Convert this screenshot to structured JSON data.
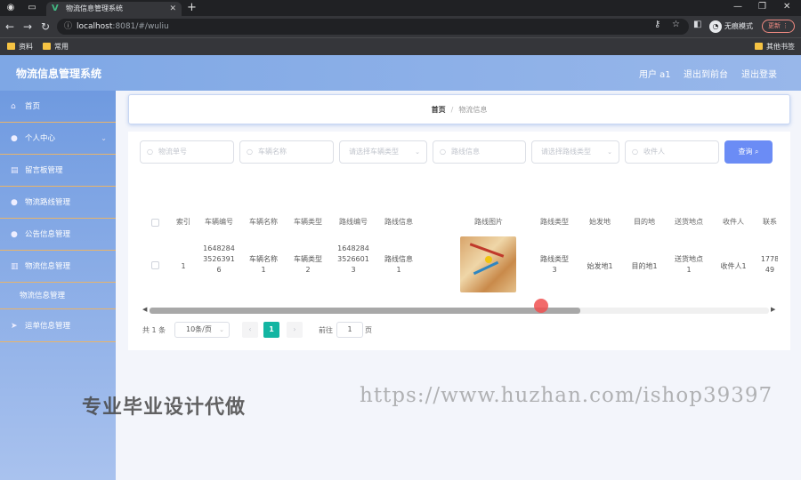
{
  "browser": {
    "tab_title": "物流信息管理系统",
    "url_host": "localhost",
    "url_port": ":8081",
    "url_path": "/#/wuliu",
    "incognito_label": "无痕模式",
    "update_label": "更新",
    "bookmarks": [
      "资料",
      "常用"
    ],
    "other_bookmarks": "其他书签",
    "accent": "#42b883"
  },
  "header": {
    "title": "物流信息管理系统",
    "user_label": "用户 a1",
    "back_label": "退出到前台",
    "logout_label": "退出登录"
  },
  "sidebar": {
    "items": [
      {
        "label": "首页",
        "icon": "home-icon"
      },
      {
        "label": "个人中心",
        "icon": "user-icon"
      },
      {
        "label": "留言板管理",
        "icon": "message-icon"
      },
      {
        "label": "物流路线管理",
        "icon": "user-icon"
      },
      {
        "label": "公告信息管理",
        "icon": "user-icon"
      },
      {
        "label": "物流信息管理",
        "icon": "document-icon"
      },
      {
        "label": "运单信息管理",
        "icon": "send-icon"
      }
    ],
    "sub_item": "物流信息管理"
  },
  "breadcrumb": {
    "home": "首页",
    "separator": "/",
    "current": "物流信息"
  },
  "search": {
    "fields": [
      {
        "placeholder": "物流单号",
        "type": "text"
      },
      {
        "placeholder": "车辆名称",
        "type": "text"
      },
      {
        "placeholder": "请选择车辆类型",
        "type": "select"
      },
      {
        "placeholder": "路线信息",
        "type": "text"
      },
      {
        "placeholder": "请选择路线类型",
        "type": "select"
      },
      {
        "placeholder": "收件人",
        "type": "text"
      }
    ],
    "button": "查询"
  },
  "table": {
    "headers": [
      "索引",
      "车辆编号",
      "车辆名称",
      "车辆类型",
      "路线编号",
      "路线信息",
      "路线图片",
      "路线类型",
      "始发地",
      "目的地",
      "送货地点",
      "收件人",
      "联系"
    ],
    "row": {
      "index": "1",
      "vehicle_no": [
        "1648284",
        "3526391",
        "6"
      ],
      "vehicle_name": [
        "车辆名称",
        "1"
      ],
      "vehicle_type": [
        "车辆类型",
        "2"
      ],
      "route_no": [
        "1648284",
        "3526601",
        "3"
      ],
      "route_info": [
        "路线信息",
        "1"
      ],
      "route_type": [
        "路线类型",
        "3"
      ],
      "origin": "始发地1",
      "destination": "目的地1",
      "delivery": [
        "送货地点",
        "1"
      ],
      "recipient": "收件人1",
      "contact": [
        "1778",
        "49"
      ]
    }
  },
  "pagination": {
    "total": "共 1 条",
    "page_size": "10条/页",
    "current_page": "1",
    "goto_label": "前往",
    "goto_value": "1",
    "page_unit": "页"
  },
  "watermarks": {
    "left": "专业毕业设计代做",
    "right": "https://www.huzhan.com/ishop39397"
  }
}
